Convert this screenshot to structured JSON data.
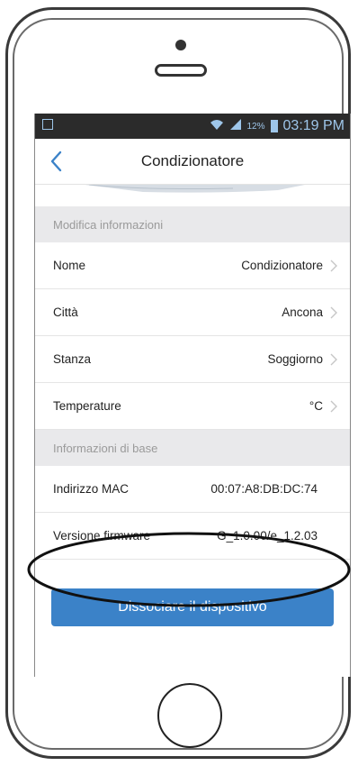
{
  "status_bar": {
    "battery_percent": "12%",
    "time": "03:19 PM"
  },
  "header": {
    "title": "Condizionatore"
  },
  "sections": [
    {
      "title": "Modifica informazioni",
      "rows": [
        {
          "label": "Nome",
          "value": "Condizionatore"
        },
        {
          "label": "Città",
          "value": "Ancona"
        },
        {
          "label": "Stanza",
          "value": "Soggiorno"
        },
        {
          "label": "Temperature",
          "value": "°C"
        }
      ]
    },
    {
      "title": "Informazioni di base",
      "rows": [
        {
          "label": "Indirizzo MAC",
          "value": "00:07:A8:DB:DC:74"
        },
        {
          "label": "Versione firmware",
          "value": "G_1.0.00/e_1.2.03"
        }
      ]
    }
  ],
  "actions": {
    "dissociate_label": "Dissociare il dispositivo"
  },
  "colors": {
    "accent": "#3b82c8",
    "status_bar_bg": "#2b2b2b",
    "section_header_bg": "#e9e9eb"
  },
  "icons": {
    "back": "chevron-left-icon",
    "row_chevron": "chevron-right-icon"
  }
}
